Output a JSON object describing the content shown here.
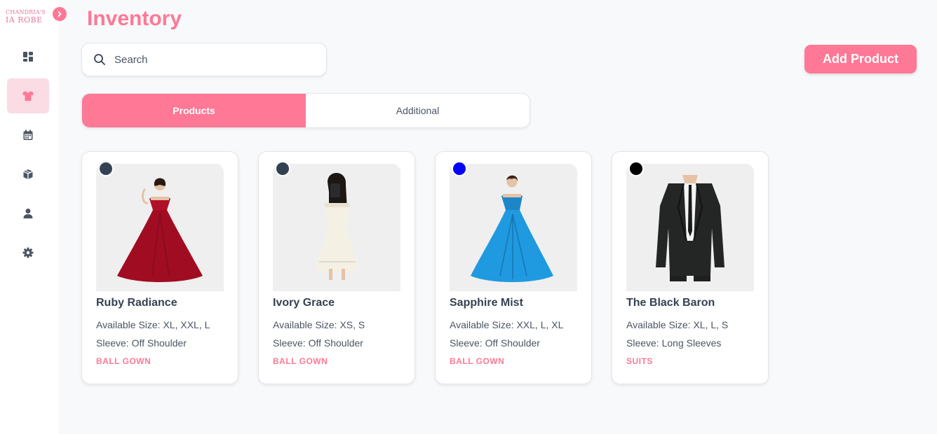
{
  "brand": {
    "logo_line1": "CHANDRIA'S",
    "logo_line2": "IA ROBE"
  },
  "sidebar": {
    "items": [
      {
        "icon": "dashboard-icon",
        "active": false
      },
      {
        "icon": "shirt-icon",
        "active": true
      },
      {
        "icon": "calendar-icon",
        "active": false
      },
      {
        "icon": "box-icon",
        "active": false
      },
      {
        "icon": "user-icon",
        "active": false
      },
      {
        "icon": "gear-icon",
        "active": false
      }
    ]
  },
  "header": {
    "title": "Inventory"
  },
  "search": {
    "placeholder": "Search",
    "value": ""
  },
  "actions": {
    "add_product_label": "Add Product"
  },
  "tabs": [
    {
      "label": "Products",
      "active": true
    },
    {
      "label": "Additional",
      "active": false
    }
  ],
  "products": [
    {
      "name": "Ruby Radiance",
      "size": "Available Size: XL, XXL, L",
      "sleeve": "Sleeve: Off Shoulder",
      "category": "BALL GOWN",
      "color": "#334155"
    },
    {
      "name": "Ivory Grace",
      "size": "Available Size: XS, S",
      "sleeve": "Sleeve: Off Shoulder",
      "category": "BALL GOWN",
      "color": "#334155"
    },
    {
      "name": "Sapphire Mist",
      "size": "Available Size: XXL, L, XL",
      "sleeve": "Sleeve: Off Shoulder",
      "category": "BALL GOWN",
      "color": "#0000ff"
    },
    {
      "name": "The Black Baron",
      "size": "Available Size: XL, L, S",
      "sleeve": "Sleeve: Long Sleeves",
      "category": "SUITS",
      "color": "#000000"
    }
  ],
  "theme": {
    "accent": "#ff7896",
    "accent_soft": "#fbdbe4",
    "text": "#374151",
    "muted": "#4b5563"
  }
}
